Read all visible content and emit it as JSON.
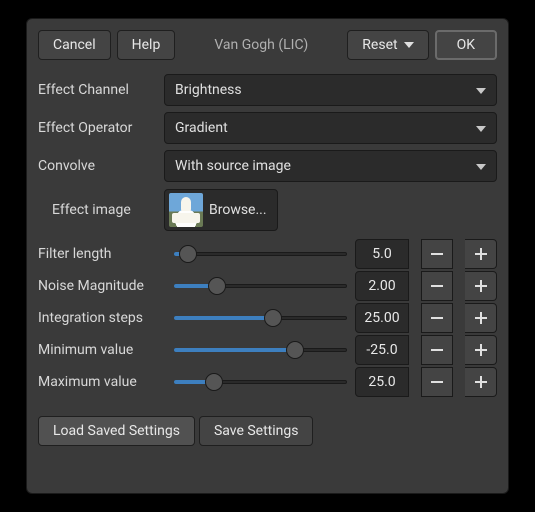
{
  "topbar": {
    "cancel": "Cancel",
    "help": "Help",
    "title": "Van Gogh (LIC)",
    "reset": "Reset",
    "ok": "OK"
  },
  "dropdowns": {
    "effect_channel": {
      "label": "Effect Channel",
      "value": "Brightness"
    },
    "effect_operator": {
      "label": "Effect Operator",
      "value": "Gradient"
    },
    "convolve": {
      "label": "Convolve",
      "value": "With source image"
    }
  },
  "effect_image": {
    "label": "Effect image",
    "browse": "Browse..."
  },
  "sliders": [
    {
      "label": "Filter length",
      "value": "5.0",
      "pct": 8
    },
    {
      "label": "Noise Magnitude",
      "value": "2.00",
      "pct": 25
    },
    {
      "label": "Integration steps",
      "value": "25.00",
      "pct": 57
    },
    {
      "label": "Minimum value",
      "value": "-25.0",
      "pct": 70
    },
    {
      "label": "Maximum value",
      "value": "25.0",
      "pct": 23
    }
  ],
  "footer": {
    "load": "Load Saved Settings",
    "save": "Save Settings"
  }
}
